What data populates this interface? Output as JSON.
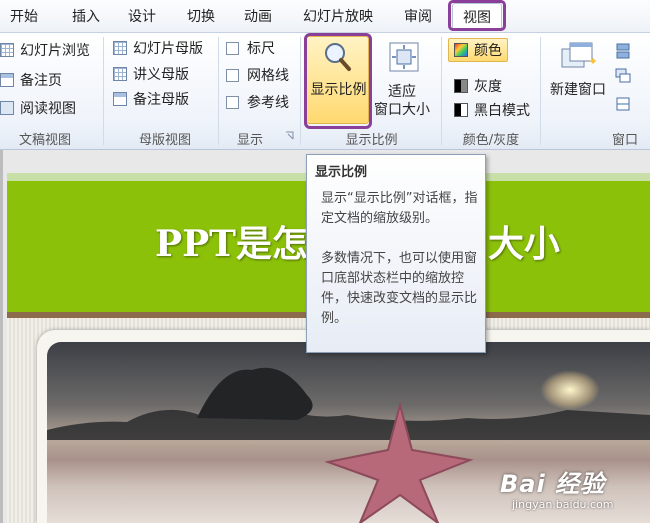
{
  "tabs": [
    "开始",
    "插入",
    "设计",
    "切换",
    "动画",
    "幻灯片放映",
    "审阅",
    "视图"
  ],
  "active_tab": "视图",
  "groups": {
    "presentation_views": {
      "label": "文稿视图",
      "items": [
        "幻灯片浏览",
        "备注页",
        "阅读视图"
      ]
    },
    "master_views": {
      "label": "母版视图",
      "items": [
        "幻灯片母版",
        "讲义母版",
        "备注母版"
      ]
    },
    "show": {
      "label": "显示",
      "items": [
        "标尺",
        "网格线",
        "参考线"
      ]
    },
    "zoom": {
      "label": "显示比例",
      "zoom_label": "显示比例",
      "fit_label_1": "适应",
      "fit_label_2": "窗口大小"
    },
    "color": {
      "label": "颜色/灰度",
      "items": [
        "颜色",
        "灰度",
        "黑白模式"
      ]
    },
    "window": {
      "label": "窗口",
      "new_window": "新建窗口"
    }
  },
  "tooltip": {
    "title": "显示比例",
    "body_1": "显示“显示比例”对话框，指定文档的缩放级别。",
    "body_2": "多数情况下，也可以使用窗口底部状态栏中的缩放控件，快速改变文档的显示比例。"
  },
  "slide": {
    "title": "PPT是怎样适应窗口大小"
  },
  "watermark": {
    "logo": "Bai 经验",
    "url": "jingyan.baidu.com"
  },
  "colors": {
    "accent_highlight": "#8a3f99",
    "slide_green": "#8cc10a",
    "selected_button": "#ffd970"
  }
}
